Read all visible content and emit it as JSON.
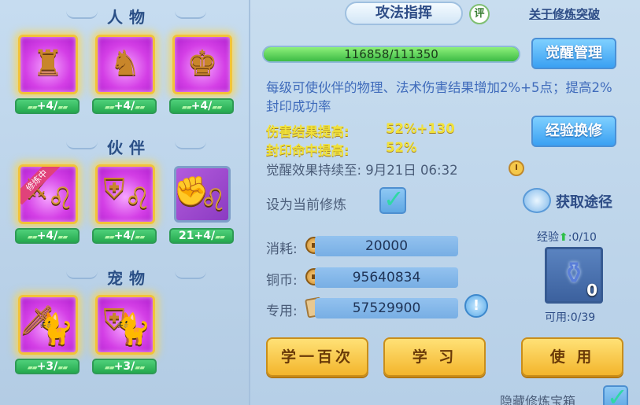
{
  "left": {
    "sections": [
      {
        "title": "人物"
      },
      {
        "title": "伙伴"
      },
      {
        "title": "宠物"
      }
    ],
    "character_slots": [
      {
        "icon": "golden-mage-figure-icon",
        "level": "+4/"
      },
      {
        "icon": "golden-armored-warrior-icon",
        "level": "+4/"
      },
      {
        "icon": "golden-warrior-icon",
        "level": "+4/"
      }
    ],
    "partner_slots": [
      {
        "icon": "golden-sword-partner-icon",
        "level": "+4/",
        "ribbon": "修炼中"
      },
      {
        "icon": "golden-shield-partner-icon",
        "level": "+4/"
      },
      {
        "icon": "golden-gauntlet-partner-icon",
        "level": "21+4/"
      }
    ],
    "pet_slots": [
      {
        "icon": "golden-sword-pet-icon",
        "level": "+3/"
      },
      {
        "icon": "golden-shield-pet-icon",
        "level": "+3/"
      }
    ]
  },
  "header": {
    "title": "攻法指挥",
    "badge": "评",
    "help_link": "关于修炼突破"
  },
  "progress": {
    "text": "116858/111350",
    "fraction": 1.0
  },
  "buttons": {
    "awaken_manage": "觉醒管理",
    "exp_exchange": "经验换修",
    "learn_hundred": "学一百次",
    "learn": "学 习",
    "use": "使 用"
  },
  "description": "每级可使伙伴的物理、法术伤害结果增加2%+5点；提高2%封印成功率",
  "stats": [
    {
      "label": "伤害结果提高:",
      "value": "52%+130"
    },
    {
      "label": "封印命中提高:",
      "value": "52%"
    }
  ],
  "duration": "觉醒效果持续至:  9月21日 06:32",
  "set_current": "设为当前修炼",
  "obtain": "获取途径",
  "resources": [
    {
      "label": "消耗:",
      "icon": "copper-coin-icon",
      "value": "20000"
    },
    {
      "label": "铜币:",
      "icon": "copper-coin-icon",
      "value": "95640834"
    },
    {
      "label": "专用:",
      "icon": "scroll-icon",
      "value": "57529900"
    }
  ],
  "exp_panel": {
    "label": "经验",
    "value": ":0/10",
    "count": "0",
    "available": "可用:0/39"
  },
  "hide_chest": "隐藏修炼宝箱",
  "colors": {
    "accent_blue": "#3aa0f2",
    "gold_button": "#f3b52c",
    "stat_yellow": "#f1e23a",
    "progress_green": "#3cbb45"
  }
}
